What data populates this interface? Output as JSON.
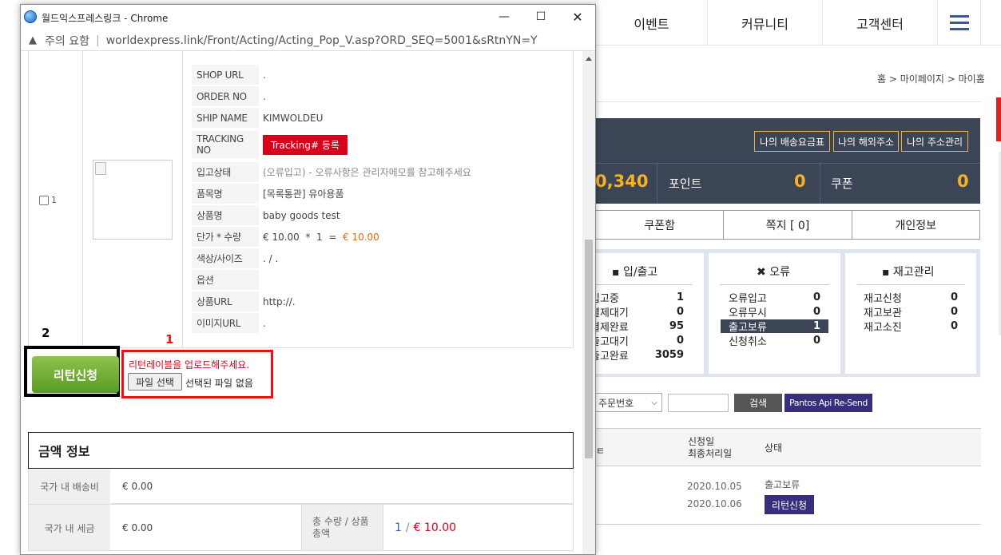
{
  "background": {
    "nav": [
      "이벤트",
      "커뮤니티",
      "고객센터"
    ],
    "breadcrumb": "홈 > 마이페이지 > 마이홈",
    "panel_buttons": [
      "나의 배송요금표",
      "나의 해외주소",
      "나의 주소관리"
    ],
    "balance_partial": "0,340",
    "point_label": "포인트",
    "point_value": "0",
    "coupon_label": "쿠폰",
    "coupon_value": "0",
    "tabs": [
      "쿠폰함",
      "쪽지 [ 0]",
      "개인정보"
    ],
    "stats": {
      "inout": {
        "title": "입/출고",
        "rows": [
          {
            "label": "입고중",
            "value": "1"
          },
          {
            "label": "결제대기",
            "value": "0"
          },
          {
            "label": "결제완료",
            "value": "95"
          },
          {
            "label": "출고대기",
            "value": "0"
          },
          {
            "label": "출고완료",
            "value": "3059"
          }
        ]
      },
      "error": {
        "title": "오류",
        "rows": [
          {
            "label": "오류입고",
            "value": "0"
          },
          {
            "label": "오류무시",
            "value": "0"
          },
          {
            "label": "출고보류",
            "value": "1"
          },
          {
            "label": "신청취소",
            "value": "0"
          }
        ]
      },
      "stock": {
        "title": "재고관리",
        "rows": [
          {
            "label": "재고신청",
            "value": "0"
          },
          {
            "label": "재고보관",
            "value": "0"
          },
          {
            "label": "재고소진",
            "value": "0"
          }
        ]
      }
    },
    "filter_select": "주문번호",
    "search_button": "검색",
    "pantos_button": "Pantos Api Re-Send",
    "result_header": {
      "date_label": "신청일\n최종처리일",
      "status_label": "상태"
    },
    "result_row": {
      "date1": "2020.10.05",
      "date2": "2020.10.06",
      "status": "출고보류",
      "return_button": "리턴신청"
    }
  },
  "popup": {
    "window_title": "월드익스프레스링크 - Chrome",
    "security_label": "주의 요함",
    "url": "worldexpress.link/Front/Acting/Acting_Pop_V.asp?ORD_SEQ=5001&sRtnYN=Y",
    "checkbox_num": "1",
    "item_rows": [
      {
        "label": "SHOP URL",
        "value": "."
      },
      {
        "label": "ORDER NO",
        "value": "."
      },
      {
        "label": "SHIP NAME",
        "value": "KIMWOLDEU"
      },
      {
        "label": "TRACKING NO",
        "value": ""
      },
      {
        "label": "입고상태",
        "value": "(오류입고) - 오류사항은 관리자메모를 참고해주세요"
      },
      {
        "label": "품목명",
        "value": "[목록통관] 유아용품"
      },
      {
        "label": "상품명",
        "value": "baby goods test"
      },
      {
        "label": "단가 * 수량",
        "value": "€ 10.00  *  1  =  "
      },
      {
        "label": "색상/사이즈",
        "value": ". / ."
      },
      {
        "label": "옵션",
        "value": ""
      },
      {
        "label": "상품URL",
        "value": "http://."
      },
      {
        "label": "이미지URL",
        "value": "."
      }
    ],
    "tracking_button": "Tracking# 등록",
    "unit_total": "€ 10.00",
    "return_button": "리턴신청",
    "annotation_2": "2",
    "annotation_1": "1",
    "upload_message": "리턴레이블을 업로드해주세요.",
    "file_button": "파일 선택",
    "file_none": "선택된 파일 없음",
    "amount_title": "금액 정보",
    "domestic_shipping_label": "국가 내 배송비",
    "domestic_shipping_value": "€ 0.00",
    "domestic_tax_label": "국가 내 세금",
    "domestic_tax_value": "€ 0.00",
    "total_qty_label": "총 수량 / 상품\n총액",
    "total_qty": "1",
    "total_amount": "€ 10.00"
  },
  "colors": {
    "accent_dark": "#3c4556",
    "gold": "#f5b223",
    "purple_button": "#36307c",
    "red_button": "#d9001b",
    "green_button": "#6aaa30"
  }
}
